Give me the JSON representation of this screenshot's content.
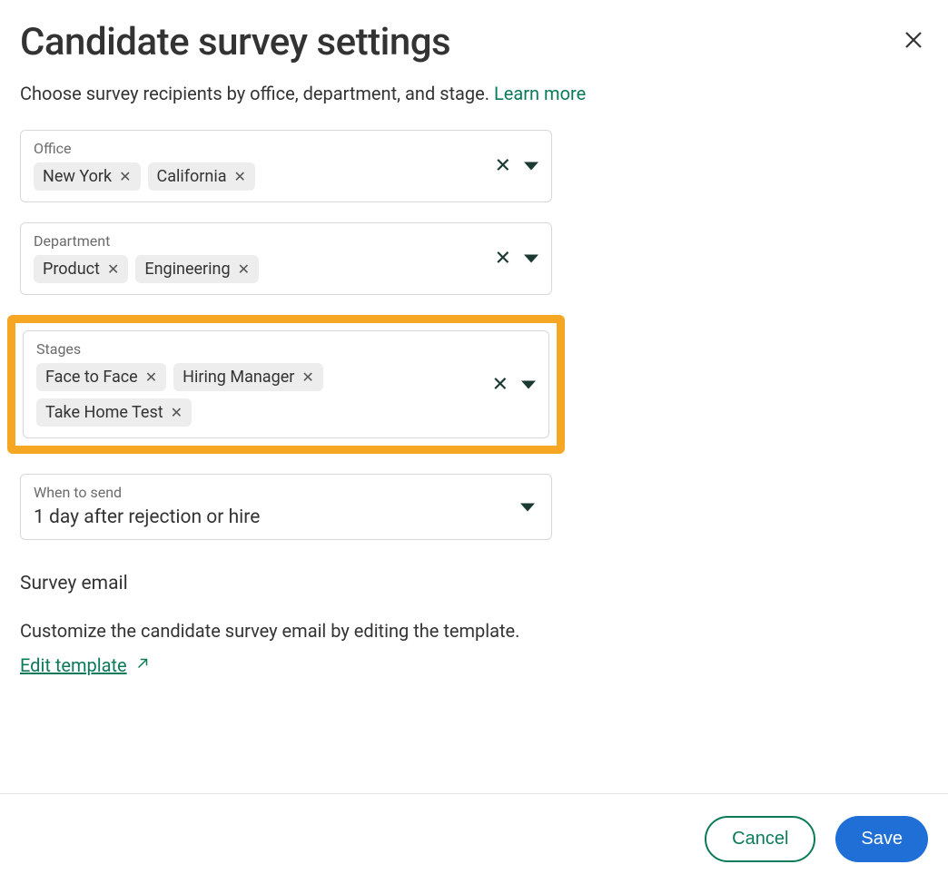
{
  "header": {
    "title": "Candidate survey settings",
    "subtitle_prefix": "Choose survey recipients by office, department, and stage. ",
    "learn_more": "Learn more"
  },
  "fields": {
    "office": {
      "label": "Office",
      "chips": [
        "New York",
        "California"
      ]
    },
    "department": {
      "label": "Department",
      "chips": [
        "Product",
        "Engineering"
      ]
    },
    "stages": {
      "label": "Stages",
      "chips": [
        "Face to Face",
        "Hiring Manager",
        "Take Home Test"
      ]
    },
    "when_to_send": {
      "label": "When to send",
      "value": "1 day after rejection or hire"
    }
  },
  "survey_email": {
    "heading": "Survey email",
    "description": "Customize the candidate survey email by editing the template.",
    "edit_link": "Edit template"
  },
  "footer": {
    "cancel": "Cancel",
    "save": "Save"
  }
}
